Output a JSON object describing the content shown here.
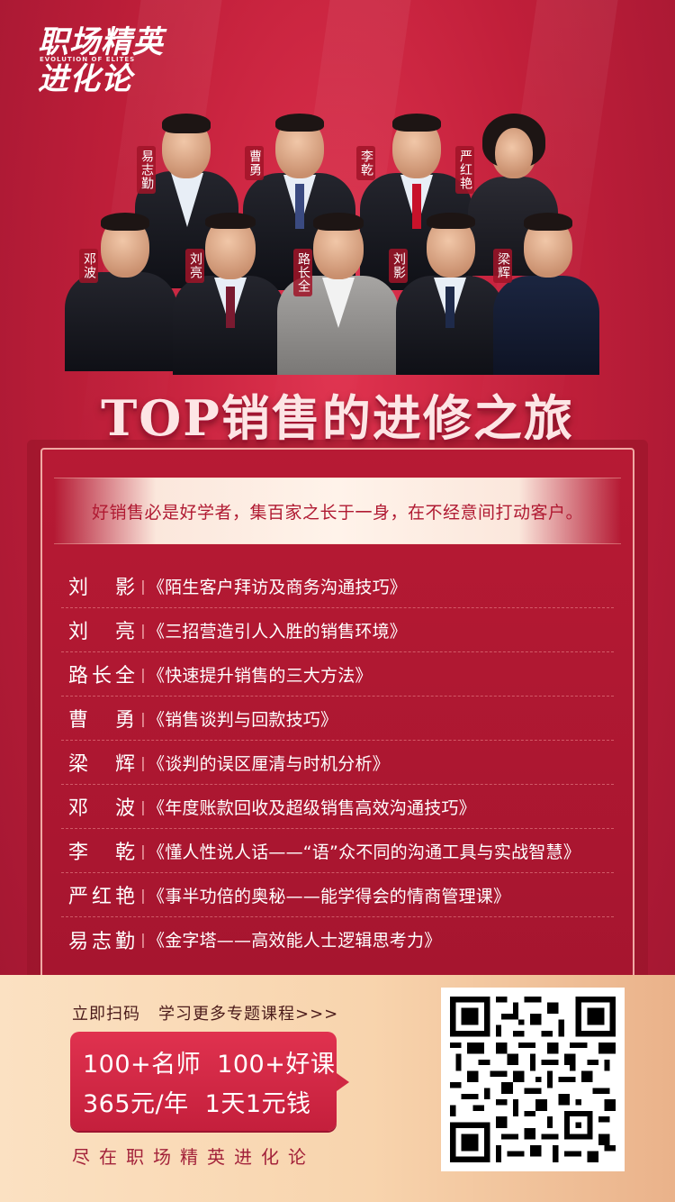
{
  "logo": {
    "line1": "职场精英",
    "tagline": "EVOLUTION OF ELITES",
    "line2": "进化论"
  },
  "speakers_photo": [
    {
      "name_vertical": "易志勤"
    },
    {
      "name_vertical": "曹勇"
    },
    {
      "name_vertical": "李乾"
    },
    {
      "name_vertical": "严红艳"
    },
    {
      "name_vertical": "邓波"
    },
    {
      "name_vertical": "刘亮"
    },
    {
      "name_vertical": "路长全"
    },
    {
      "name_vertical": "刘影"
    },
    {
      "name_vertical": "梁辉"
    }
  ],
  "title": "TOP销售的进修之旅",
  "slogan": "好销售必是好学者，集百家之长于一身，在不经意间打动客户。",
  "courses": [
    {
      "name": "刘影",
      "sep": "|",
      "course": "《陌生客户拜访及商务沟通技巧》"
    },
    {
      "name": "刘亮",
      "sep": "|",
      "course": "《三招营造引人入胜的销售环境》"
    },
    {
      "name": "路长全",
      "sep": "|",
      "course": "《快速提升销售的三大方法》"
    },
    {
      "name": "曹勇",
      "sep": "|",
      "course": "《销售谈判与回款技巧》"
    },
    {
      "name": "梁辉",
      "sep": "|",
      "course": "《谈判的误区厘清与时机分析》"
    },
    {
      "name": "邓波",
      "sep": "|",
      "course": "《年度账款回收及超级销售高效沟通技巧》"
    },
    {
      "name": "李乾",
      "sep": "|",
      "course": "《懂人性说人话——“语”众不同的沟通工具与实战智慧》"
    },
    {
      "name": "严红艳",
      "sep": "|",
      "course": "《事半功倍的奥秘——能学得会的情商管理课》"
    },
    {
      "name": "易志勤",
      "sep": "|",
      "course": "《金字塔——高效能人士逻辑思考力》"
    }
  ],
  "cta": {
    "scan": "立即扫码",
    "more": "学习更多专题课程>>>",
    "promo_line1_a": "100+名师",
    "promo_line1_b": "100+好课",
    "promo_line2_a": "365元/年",
    "promo_line2_b": "1天1元钱",
    "footer": "尽在职场精英进化论"
  },
  "colors": {
    "primary_red": "#c8213e",
    "cream": "#fbe1c2",
    "slogan_red": "#b01a32"
  }
}
